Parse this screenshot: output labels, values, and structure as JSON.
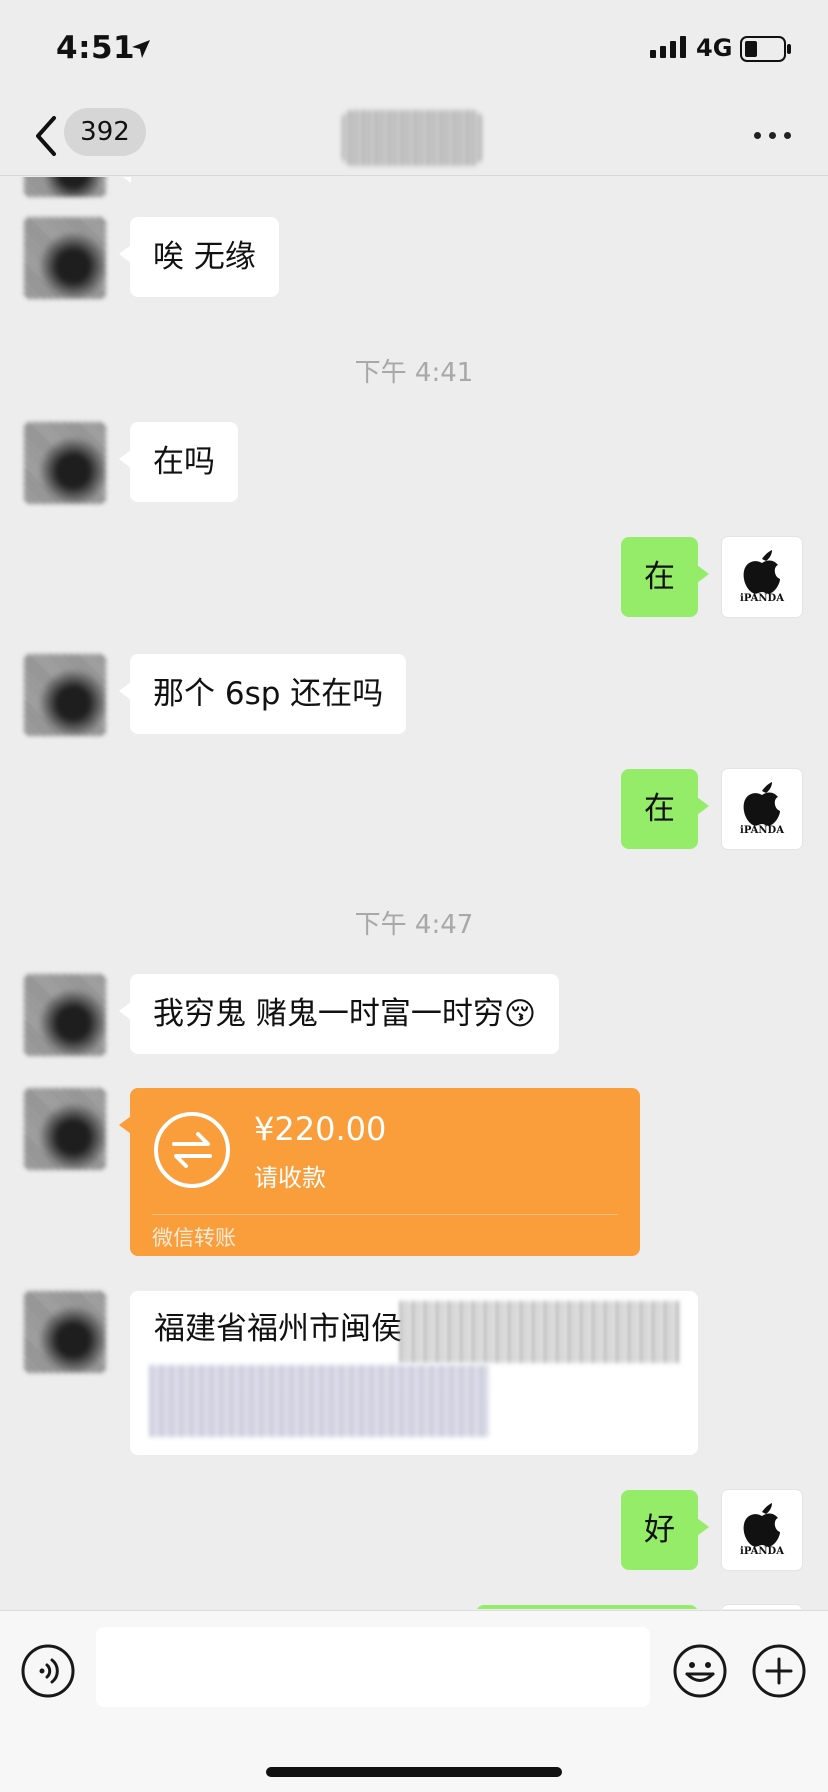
{
  "status_bar": {
    "time": "4:51",
    "network": "4G"
  },
  "nav": {
    "unread_count": "392"
  },
  "messages": {
    "msg1": "唉 无缘",
    "time1": "下午 4:41",
    "msg2": "在吗",
    "msg3": "在",
    "msg4": "那个 6sp 还在吗",
    "msg5": "在",
    "time2": "下午 4:47",
    "msg6": "我穷鬼 赌鬼一时富一时穷",
    "msg6_emoji": "😚",
    "transfer": {
      "amount": "¥220.00",
      "status": "请收款",
      "footer": "微信转账"
    },
    "address": "福建省福州市闽侯",
    "msg8": "好"
  },
  "avatar": {
    "brand_label": "iPANDA"
  },
  "input": {
    "placeholder": ""
  },
  "colors": {
    "background": "#ededed",
    "sent_bubble": "#95ec69",
    "received_bubble": "#ffffff",
    "transfer_card": "#fa9d3b"
  }
}
